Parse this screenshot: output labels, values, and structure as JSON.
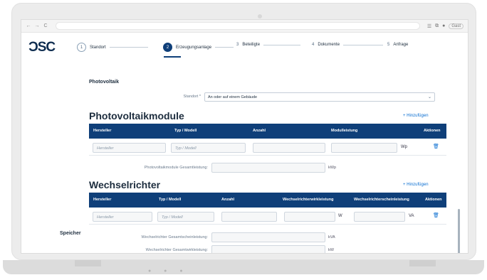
{
  "browser": {
    "nav": [
      "←",
      "→",
      "C"
    ],
    "right_icons": [
      "☰",
      "⧉",
      "●"
    ],
    "pill": "Gast"
  },
  "logo": "ƆSC",
  "stepper": [
    {
      "num": "1",
      "label": "Standort",
      "active": false
    },
    {
      "num": "2",
      "label": "Erzeugungsanlage",
      "active": true
    },
    {
      "num": "3",
      "label": "Beteiligte",
      "active": false
    },
    {
      "num": "4",
      "label": "Dokumente",
      "active": false
    },
    {
      "num": "5",
      "label": "Anfrage",
      "active": false
    }
  ],
  "photovoltaik": {
    "title": "Photovoltaik",
    "standort_label": "Standort *",
    "standort_value": "An oder auf einem Gebäude"
  },
  "pv_module": {
    "title": "Photovoltaikmodule",
    "add": "+ Hinzufügen",
    "headers": [
      "Hersteller",
      "Typ / Modell",
      "Anzahl",
      "Modulleistung",
      "Aktionen"
    ],
    "row": {
      "hersteller_ph": "Hersteller",
      "typ_ph": "Typ / Modell",
      "unit": "Wp"
    },
    "sum_label": "Photovoltaikmodule Gesamtleistung:",
    "sum_unit": "kWp"
  },
  "wechselrichter": {
    "title": "Wechselrichter",
    "add": "+ Hinzufügen",
    "headers": [
      "Hersteller",
      "Typ / Modell",
      "Anzahl",
      "Wechselrichterwirkleistung",
      "Wechselrichterscheinleistung",
      "Aktionen"
    ],
    "row": {
      "hersteller_ph": "Hersteller",
      "typ_ph": "Typ / Modell",
      "unit_w": "W",
      "unit_va": "VA"
    },
    "sum1_label": "Wechselrichter Gesamtscheinleistung:",
    "sum1_unit": "kVA",
    "sum2_label": "Wechselrichter Gesamtwirkleistung:",
    "sum2_unit": "kW"
  },
  "speicher": "Speicher",
  "icons": {
    "trash": "trash-icon",
    "chevron": "chevron-down-icon"
  },
  "colors": {
    "primary": "#0f3f79",
    "link": "#0a6ed1"
  }
}
